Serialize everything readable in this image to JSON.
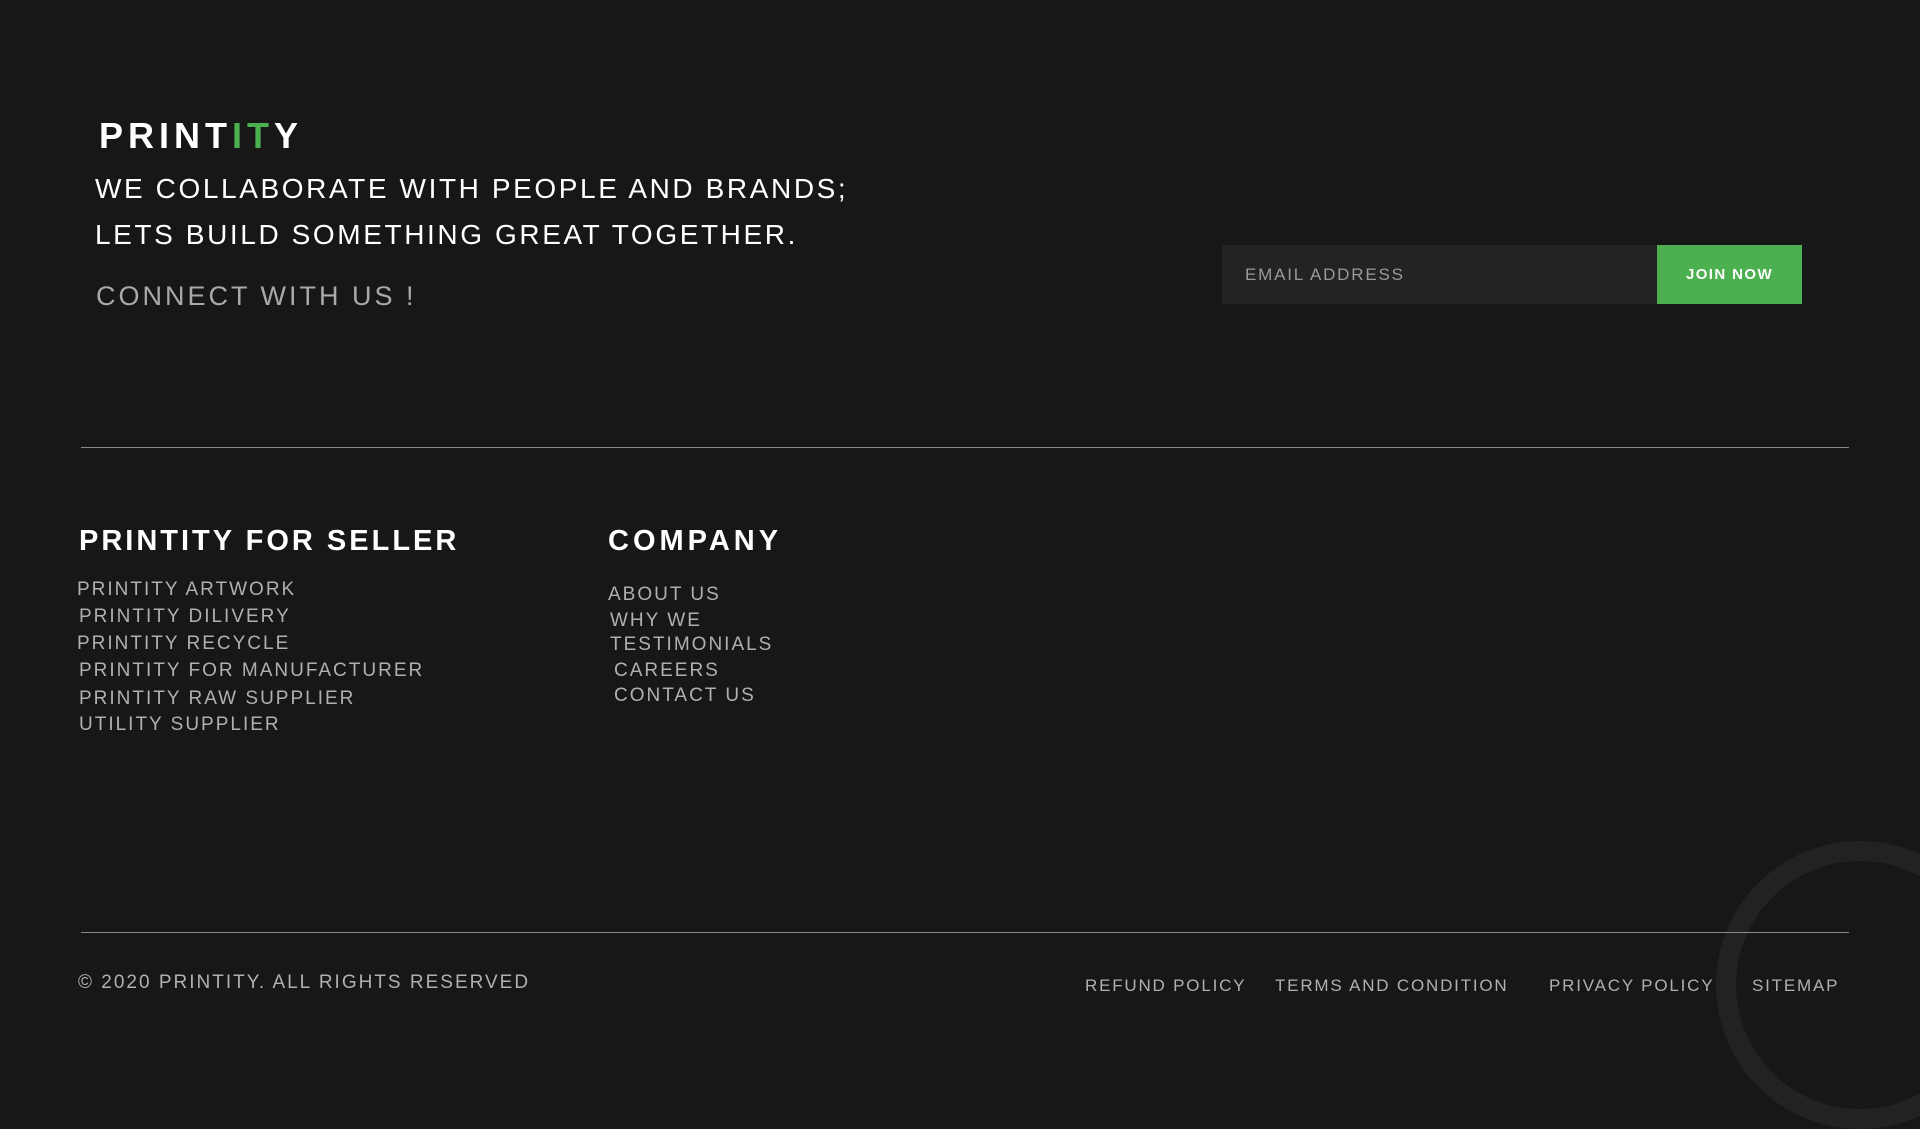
{
  "brand": {
    "logo_part1": "PRINT",
    "logo_accent": "IT",
    "logo_part2": "Y",
    "accent_color": "#4caf50"
  },
  "hero": {
    "tagline_line1": "WE COLLABORATE WITH PEOPLE AND BRANDS;",
    "tagline_line2": "LETS BUILD SOMETHING GREAT TOGETHER.",
    "connect": "CONNECT WITH US !"
  },
  "newsletter": {
    "email_placeholder": "EMAIL ADDRESS",
    "email_value": "",
    "join_label": "JOIN NOW"
  },
  "seller": {
    "heading": "PRINTITY FOR SELLER",
    "links": [
      "PRINTITY ARTWORK",
      "PRINTITY DILIVERY",
      "PRINTITY RECYCLE",
      "PRINTITY FOR MANUFACTURER",
      "PRINTITY RAW SUPPLIER",
      "UTILITY SUPPLIER"
    ]
  },
  "company": {
    "heading": "COMPANY",
    "links": [
      "ABOUT US",
      "WHY WE",
      "TESTIMONIALS",
      "CAREERS",
      "CONTACT US"
    ]
  },
  "footer": {
    "copyright": "© 2020 PRINTITY. ALL RIGHTS RESERVED",
    "legal_links": [
      "REFUND POLICY",
      "TERMS AND CONDITION",
      "PRIVACY POLICY",
      "SITEMAP"
    ]
  }
}
